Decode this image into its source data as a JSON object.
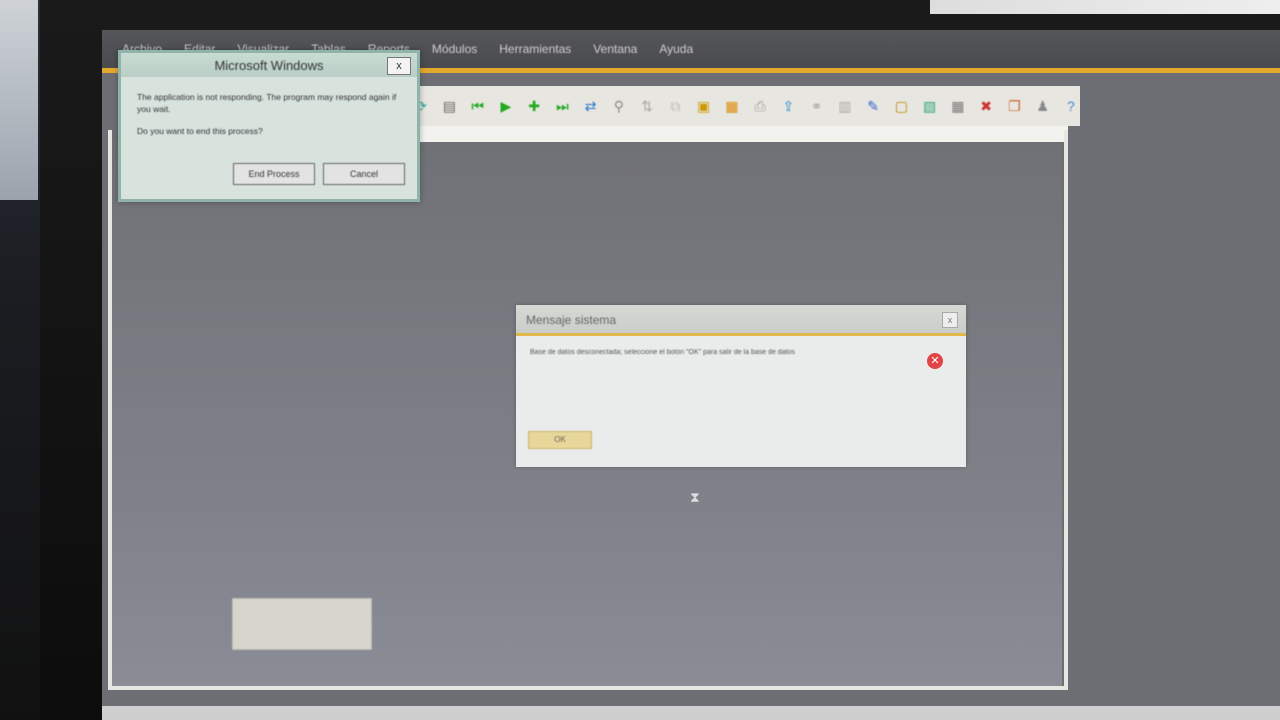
{
  "menu": {
    "items": [
      "Archivo",
      "Editar",
      "Visualizar",
      "Tablas",
      "Reports",
      "Módulos",
      "Herramientas",
      "Ventana",
      "Ayuda"
    ]
  },
  "ms_dialog": {
    "title": "Microsoft Windows",
    "close_label": "x",
    "message": "The application is not responding. The program may respond again if you wait.",
    "question": "Do you want to end this process?",
    "end_process_label": "End Process",
    "cancel_label": "Cancel"
  },
  "system_dialog": {
    "title": "Mensaje sistema",
    "close_label": "x",
    "message": "Base de datos desconectada; seleccione el botón \"OK\" para salir de la base de datos",
    "ok_label": "OK",
    "icon": "error-icon"
  },
  "toolbar": {
    "icons": [
      "refresh-icon",
      "document-icon",
      "first-record-icon",
      "next-icon",
      "add-icon",
      "last-record-icon",
      "sync-icon",
      "filter-icon",
      "sort-icon",
      "copy-icon",
      "paste-icon",
      "report-icon",
      "print-icon",
      "export-icon",
      "attach-icon",
      "chart-icon",
      "edit-icon",
      "file-icon",
      "template-icon",
      "table-icon",
      "delete-icon",
      "window-icon",
      "user-icon",
      "help-icon"
    ]
  },
  "colors": {
    "accent": "#e3a92c",
    "workspace": "#7a7c84",
    "error": "#e04444"
  }
}
